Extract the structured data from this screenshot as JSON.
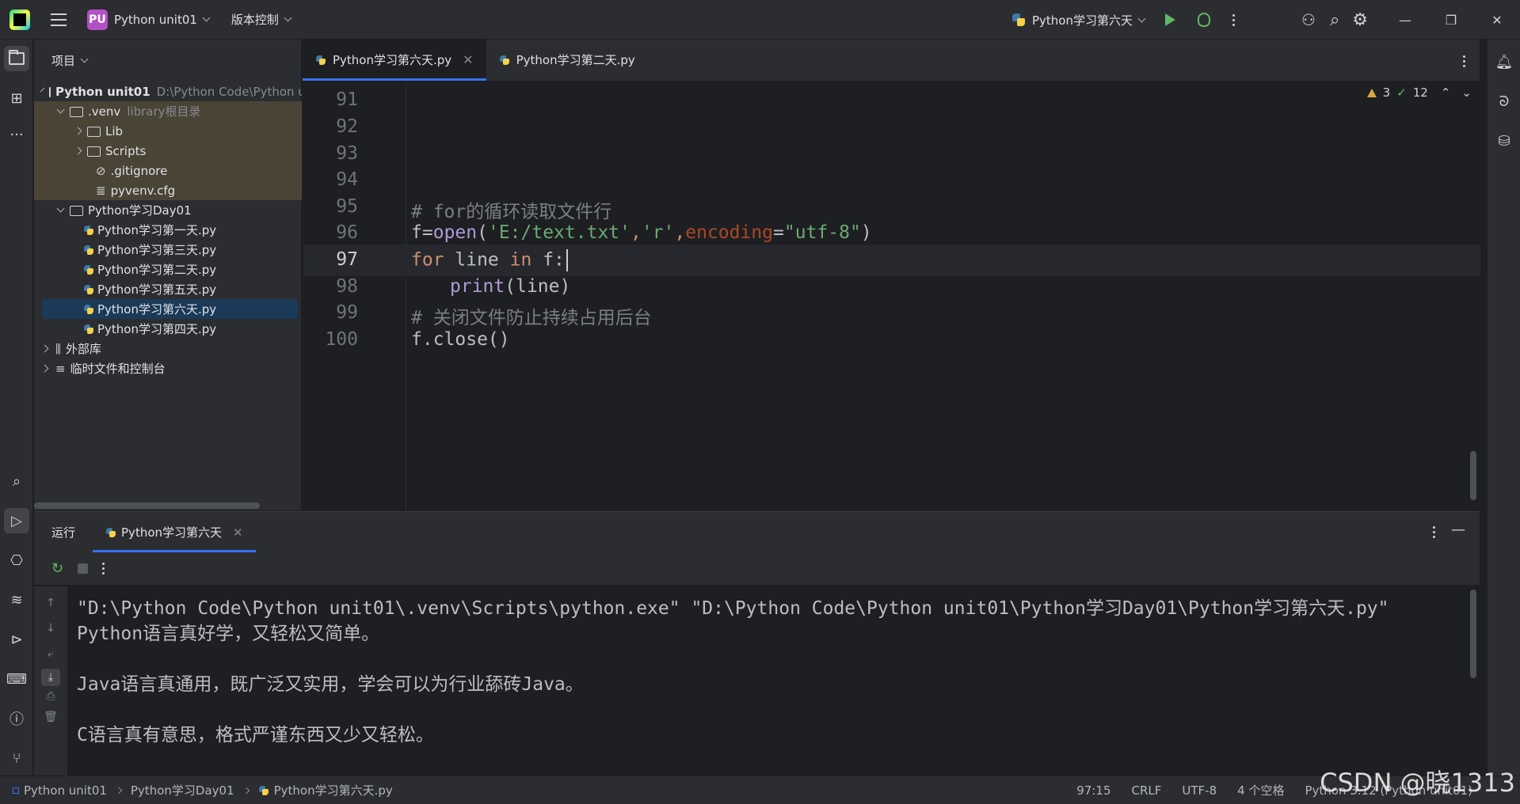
{
  "titlebar": {
    "project_badge": "PU",
    "project_name": "Python unit01",
    "vcs": "版本控制",
    "run_config": "Python学习第六天"
  },
  "project_panel": {
    "title": "项目",
    "root_name": "Python unit01",
    "root_path": "D:\\Python Code\\Python unit01",
    "venv_name": ".venv",
    "venv_note": "library根目录",
    "lib": "Lib",
    "scripts": "Scripts",
    "gitignore": ".gitignore",
    "pyvenv": "pyvenv.cfg",
    "day01": "Python学习Day01",
    "files": [
      "Python学习第一天.py",
      "Python学习第三天.py",
      "Python学习第二天.py",
      "Python学习第五天.py",
      "Python学习第六天.py",
      "Python学习第四天.py"
    ],
    "ext_libs": "外部库",
    "scratches": "临时文件和控制台"
  },
  "editor": {
    "tabs": [
      "Python学习第六天.py",
      "Python学习第二天.py"
    ],
    "warnings": "3",
    "weak_warnings": "12",
    "line_numbers": [
      "91",
      "92",
      "93",
      "94",
      "95",
      "96",
      "97",
      "98",
      "99",
      "100"
    ],
    "code": {
      "l95": "# for的循环读取文件行",
      "l96_f": "f",
      "l96_eq": "=",
      "l96_open": "open",
      "l96_p1": "(",
      "l96_s1": "'E:/text.txt'",
      "l96_c1": ",",
      "l96_s2": "'r'",
      "l96_c2": ",",
      "l96_kw": "encoding",
      "l96_eq2": "=",
      "l96_s3": "\"utf-8\"",
      "l96_p2": ")",
      "l97_for": "for",
      "l97_line": " line ",
      "l97_in": "in",
      "l97_rest": " f:",
      "l98_print": "print",
      "l98_rest": "(line)",
      "l99": "# 关闭文件防止持续占用后台",
      "l100": "f.close()"
    }
  },
  "run_panel": {
    "title": "运行",
    "tab": "Python学习第六天",
    "output": [
      "\"D:\\Python Code\\Python unit01\\.venv\\Scripts\\python.exe\" \"D:\\Python Code\\Python unit01\\Python学习Day01\\Python学习第六天.py\"",
      "Python语言真好学，又轻松又简单。",
      "",
      "Java语言真通用，既广泛又实用，学会可以为行业舔砖Java。",
      "",
      "C语言真有意思，格式严谨东西又少又轻松。"
    ]
  },
  "statusbar": {
    "crumb1": "Python unit01",
    "crumb2": "Python学习Day01",
    "crumb3": "Python学习第六天.py",
    "position": "97:15",
    "line_sep": "CRLF",
    "encoding": "UTF-8",
    "indent": "4 个空格",
    "interpreter": "Python 3.12 (Python unit01)"
  },
  "watermark": "CSDN @晓1313"
}
